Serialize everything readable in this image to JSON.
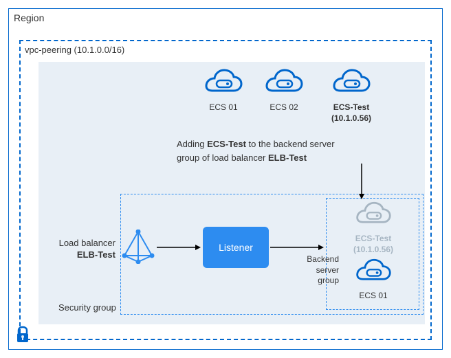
{
  "region": {
    "label": "Region"
  },
  "vpc": {
    "label": "vpc-peering (10.1.0.0/16)"
  },
  "ecs": {
    "ecs01": {
      "label": "ECS 01"
    },
    "ecs02": {
      "label": "ECS 02"
    },
    "ecsTest": {
      "label": "ECS-Test",
      "ip": "(10.1.0.56)"
    },
    "ecsTestGhost": {
      "label": "ECS-Test",
      "ip": "(10.1.0.56)"
    },
    "backendEcs01": {
      "label": "ECS 01"
    }
  },
  "description": {
    "line1": "Adding ",
    "bold1": "ECS-Test",
    "mid": " to the backend server",
    "line2": "group of load balancer ",
    "bold2": "ELB-Test"
  },
  "elb": {
    "prefix": "Load balancer",
    "name": "ELB-Test"
  },
  "listener": {
    "label": "Listener"
  },
  "backendGroup": {
    "line1": "Backend",
    "line2": "server",
    "line3": "group"
  },
  "securityGroup": {
    "label": "Security group"
  },
  "colors": {
    "primary": "#0066cc",
    "accent": "#2d8cf0",
    "ghost": "#a6b5c2"
  }
}
